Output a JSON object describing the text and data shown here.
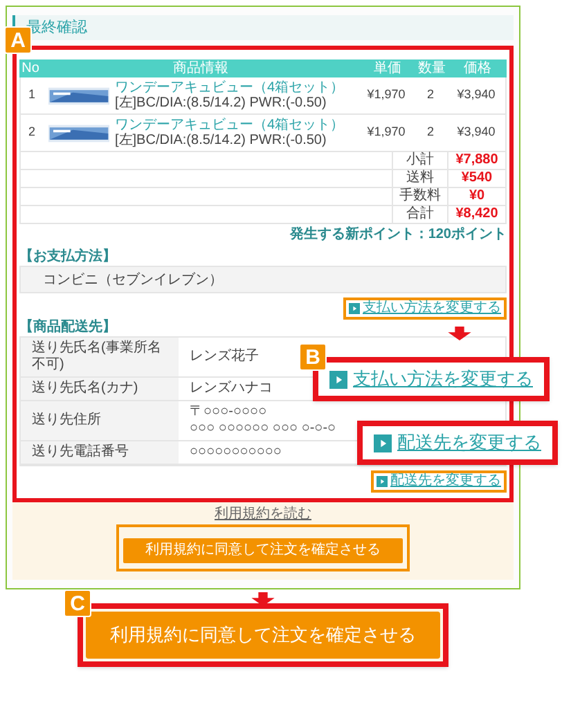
{
  "title": "最終確認",
  "section_badge": "A",
  "table": {
    "columns": [
      "No",
      "商品情報",
      "単価",
      "数量",
      "価格"
    ],
    "rows": [
      {
        "no": "1",
        "name": "ワンデーアキュビュー（4箱セット）",
        "spec": "[左]BC/DIA:(8.5/14.2) PWR:(-0.50)",
        "unit_price": "¥1,970",
        "quantity": "2",
        "price": "¥3,940"
      },
      {
        "no": "2",
        "name": "ワンデーアキュビュー（4箱セット）",
        "spec": "[左]BC/DIA:(8.5/14.2) PWR:(-0.50)",
        "unit_price": "¥1,970",
        "quantity": "2",
        "price": "¥3,940"
      }
    ],
    "summary": [
      {
        "label": "小計",
        "value": "¥7,880"
      },
      {
        "label": "送料",
        "value": "¥540"
      },
      {
        "label": "手数料",
        "value": "¥0"
      },
      {
        "label": "合計",
        "value": "¥8,420"
      }
    ]
  },
  "points": "発生する新ポイント：120ポイント",
  "payment": {
    "heading": "【お支払方法】",
    "method": "コンビニ（セブンイレブン）",
    "link": "支払い方法を変更する"
  },
  "delivery": {
    "heading": "【商品配送先】",
    "rows": [
      {
        "label": "送り先氏名(事業所名不可)",
        "lines": [
          "レンズ花子"
        ]
      },
      {
        "label": "送り先氏名(カナ)",
        "lines": [
          "レンズハナコ"
        ]
      },
      {
        "label": "送り先住所",
        "lines": [
          "〒○○○-○○○○",
          "○○○ ○○○○○○ ○○○ ○-○-○"
        ]
      },
      {
        "label": "送り先電話番号",
        "lines": [
          "○○○○○○○○○○○"
        ]
      }
    ],
    "link": "配送先を変更する"
  },
  "terms_link": "利用規約を読む",
  "confirm_button": "利用規約に同意して注文を確定させる",
  "callouts": [
    {
      "badge": "B",
      "kind": "link",
      "text": "支払い方法を変更する"
    },
    {
      "kind": "link",
      "text": "配送先を変更する"
    },
    {
      "badge": "C",
      "kind": "button",
      "text": "利用規約に同意して注文を確定させる"
    }
  ]
}
